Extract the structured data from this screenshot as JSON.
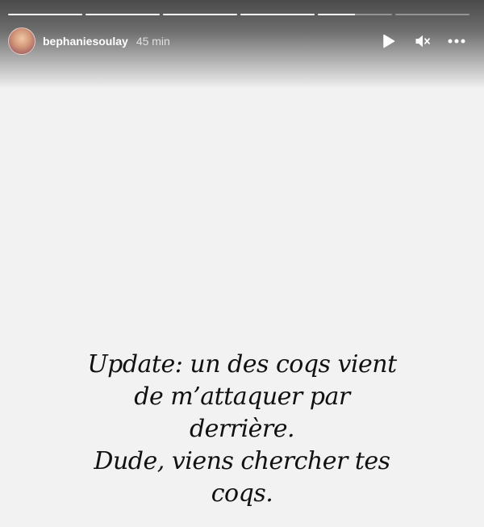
{
  "story": {
    "progress_segments": [
      1,
      1,
      1,
      1,
      0.5,
      0
    ],
    "user": {
      "username": "bephaniesoulay",
      "time_ago": "45 min"
    },
    "controls": {
      "play_icon": "play-icon",
      "mute_icon": "muted-speaker-icon",
      "more_icon": "more-options-icon"
    },
    "caption_lines": [
      "Update: un des coqs vient",
      "de m’attaquer par",
      "derrière.",
      "Dude, viens chercher tes",
      "coqs."
    ]
  }
}
